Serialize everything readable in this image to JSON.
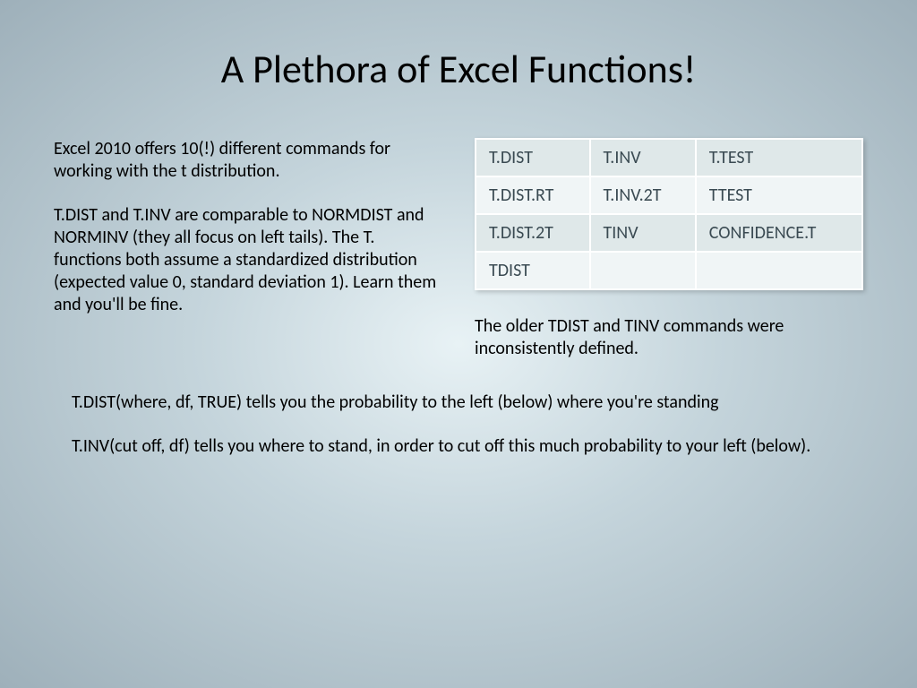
{
  "title": "A Plethora of Excel Functions!",
  "left": {
    "p1": "Excel 2010 offers 10(!) different commands for working with the t distribution.",
    "p2": "T.DIST and T.INV are comparable to NORMDIST and NORMINV (they all focus on left tails).  The T. functions both assume a standardized distribution (expected value 0, standard deviation 1).  Learn them and you'll be fine."
  },
  "table": {
    "r0c0": "T.DIST",
    "r0c1": "T.INV",
    "r0c2": "T.TEST",
    "r1c0": "T.DIST.RT",
    "r1c1": "T.INV.2T",
    "r1c2": "TTEST",
    "r2c0": "T.DIST.2T",
    "r2c1": "TINV",
    "r2c2": "CONFIDENCE.T",
    "r3c0": "TDIST",
    "r3c1": "",
    "r3c2": ""
  },
  "caption": "The older TDIST and TINV commands were inconsistently defined.",
  "bottom": {
    "p1": "T.DIST(where, df, TRUE) tells you the probability to the left (below) where you're standing",
    "p2": "T.INV(cut off, df) tells you where to stand, in order to cut off this much probability to your left (below)."
  }
}
